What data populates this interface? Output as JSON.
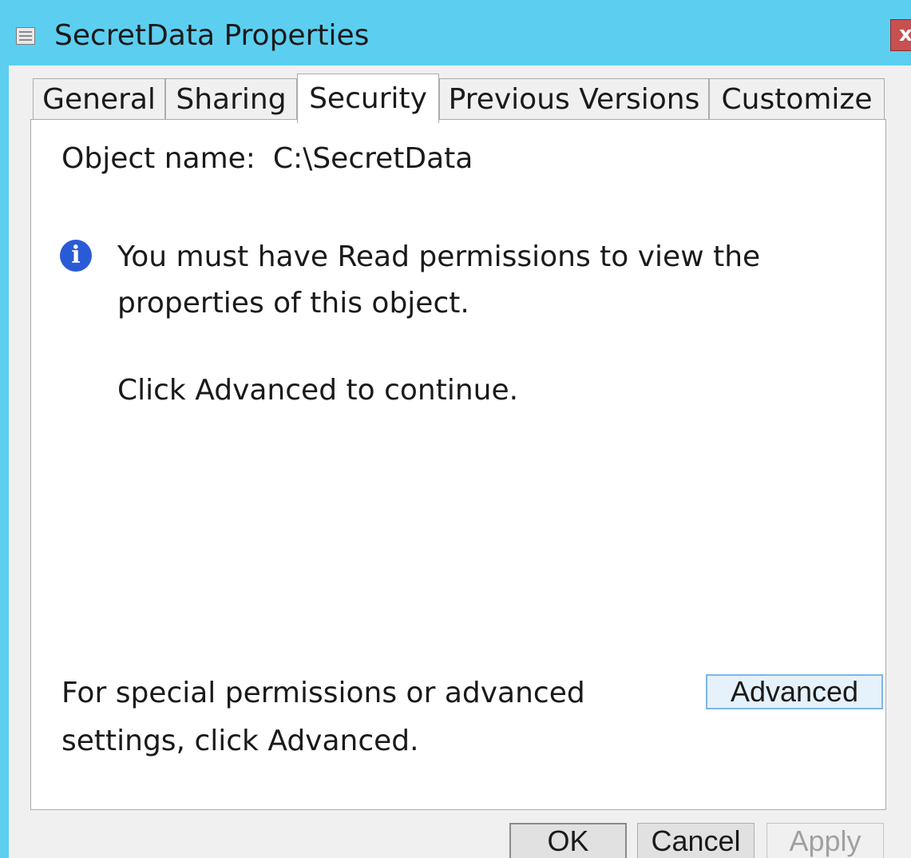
{
  "window": {
    "title": "SecretData Properties",
    "close_glyph": "x",
    "titlebar_color": "#5ccff0"
  },
  "tabs": [
    {
      "label": "General",
      "active": false
    },
    {
      "label": "Sharing",
      "active": false
    },
    {
      "label": "Security",
      "active": true
    },
    {
      "label": "Previous Versions",
      "active": false
    },
    {
      "label": "Customize",
      "active": false
    }
  ],
  "security": {
    "object_name_label": "Object name:",
    "object_name_value": "C:\\SecretData",
    "info_icon": "info-icon",
    "message_line1": "You must have Read permissions to view the",
    "message_line2": "properties of this object.",
    "continue_text": "Click Advanced to continue.",
    "special_line1": "For special permissions or advanced",
    "special_line2": "settings, click Advanced.",
    "advanced_label": "Advanced"
  },
  "buttons": {
    "ok_label": "OK",
    "cancel_label": "Cancel",
    "apply_label": "Apply",
    "apply_enabled": false
  }
}
